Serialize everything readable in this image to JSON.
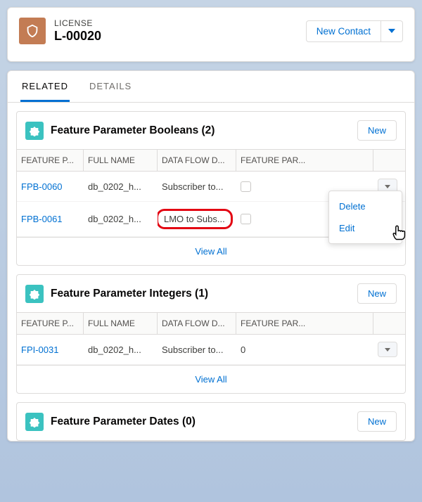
{
  "header": {
    "object_label": "LICENSE",
    "record_name": "L-00020",
    "new_contact_label": "New Contact"
  },
  "tabs": {
    "related": "RELATED",
    "details": "DETAILS"
  },
  "columns": {
    "c1": "FEATURE P...",
    "c2": "FULL NAME",
    "c3": "DATA FLOW D...",
    "c4": "FEATURE PAR..."
  },
  "booleans": {
    "title": "Feature Parameter Booleans (2)",
    "new": "New",
    "rows": [
      {
        "id": "FPB-0060",
        "full_name": "db_0202_h...",
        "flow": "Subscriber to..."
      },
      {
        "id": "FPB-0061",
        "full_name": "db_0202_h...",
        "flow": "LMO to Subs..."
      }
    ],
    "view_all": "View All"
  },
  "integers": {
    "title": "Feature Parameter Integers (1)",
    "new": "New",
    "rows": [
      {
        "id": "FPI-0031",
        "full_name": "db_0202_h...",
        "flow": "Subscriber to...",
        "value": "0"
      }
    ],
    "view_all": "View All"
  },
  "dates": {
    "title": "Feature Parameter Dates (0)",
    "new": "New"
  },
  "menu": {
    "delete": "Delete",
    "edit": "Edit"
  }
}
